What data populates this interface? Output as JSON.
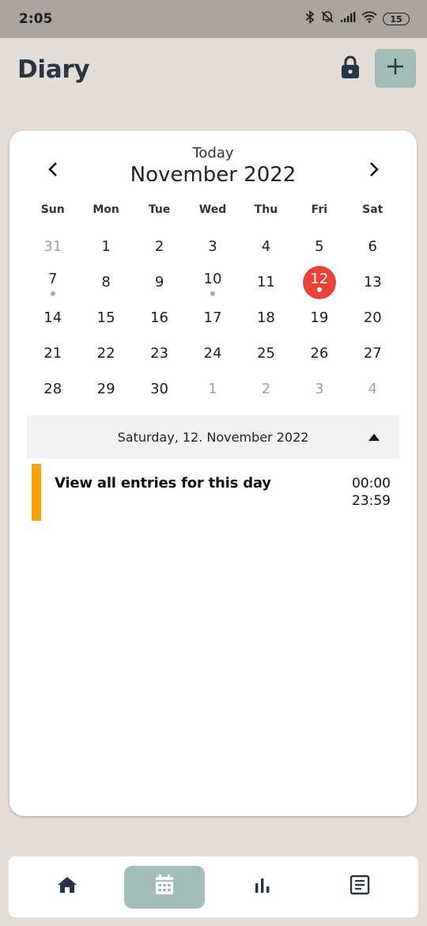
{
  "status_bar": {
    "time": "2:05",
    "battery": "15",
    "icons": [
      "bluetooth-icon",
      "mute-icon",
      "signal-icon",
      "wifi-icon",
      "battery-icon"
    ]
  },
  "header": {
    "title": "Diary",
    "lock_icon": "lock-icon",
    "add_icon": "plus-icon"
  },
  "calendar": {
    "today_label": "Today",
    "month_label": "November 2022",
    "weekdays": [
      "Sun",
      "Mon",
      "Tue",
      "Wed",
      "Thu",
      "Fri",
      "Sat"
    ],
    "days": [
      {
        "n": "31",
        "muted": true
      },
      {
        "n": "1"
      },
      {
        "n": "2"
      },
      {
        "n": "3"
      },
      {
        "n": "4"
      },
      {
        "n": "5"
      },
      {
        "n": "6"
      },
      {
        "n": "7",
        "dot": true
      },
      {
        "n": "8"
      },
      {
        "n": "9"
      },
      {
        "n": "10",
        "dot": true
      },
      {
        "n": "11"
      },
      {
        "n": "12",
        "selected": true,
        "dot": true
      },
      {
        "n": "13"
      },
      {
        "n": "14"
      },
      {
        "n": "15"
      },
      {
        "n": "16"
      },
      {
        "n": "17"
      },
      {
        "n": "18"
      },
      {
        "n": "19"
      },
      {
        "n": "20"
      },
      {
        "n": "21"
      },
      {
        "n": "22"
      },
      {
        "n": "23"
      },
      {
        "n": "24"
      },
      {
        "n": "25"
      },
      {
        "n": "26"
      },
      {
        "n": "27"
      },
      {
        "n": "28"
      },
      {
        "n": "29"
      },
      {
        "n": "30"
      },
      {
        "n": "1",
        "muted": true
      },
      {
        "n": "2",
        "muted": true
      },
      {
        "n": "3",
        "muted": true
      },
      {
        "n": "4",
        "muted": true
      }
    ]
  },
  "selected_day": {
    "label": "Saturday, 12. November 2022"
  },
  "entry": {
    "title": "View all entries for this day",
    "start": "00:00",
    "end": "23:59"
  },
  "colors": {
    "accent": "#a2bcb8",
    "selected_day": "#e8423a",
    "entry_bar": "#f7a10b",
    "title": "#263645"
  },
  "bottom_nav": [
    {
      "icon": "home-icon",
      "active": false
    },
    {
      "icon": "calendar-icon",
      "active": true
    },
    {
      "icon": "bar-chart-icon",
      "active": false
    },
    {
      "icon": "notes-icon",
      "active": false
    }
  ]
}
